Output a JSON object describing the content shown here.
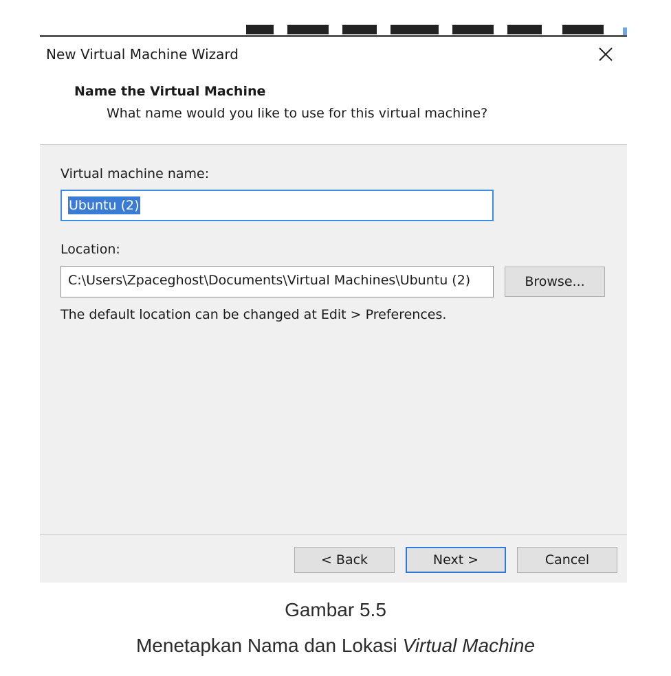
{
  "dialog": {
    "title": "New Virtual Machine Wizard",
    "header_title": "Name the Virtual Machine",
    "header_subtitle": "What name would you like to use for this virtual machine?",
    "name_label": "Virtual machine name:",
    "name_value": "Ubuntu (2)",
    "location_label": "Location:",
    "location_value": "C:\\Users\\Zpaceghost\\Documents\\Virtual Machines\\Ubuntu (2)",
    "browse_label": "Browse...",
    "hint": "The default location can be changed at Edit > Preferences.",
    "back_label": "< Back",
    "next_label": "Next >",
    "cancel_label": "Cancel"
  },
  "caption": {
    "figure": "Gambar 5.5",
    "text_plain": "Menetapkan Nama dan Lokasi ",
    "text_italic": "Virtual Machine"
  },
  "icons": {
    "close": "close-icon"
  },
  "colors": {
    "accent": "#3c8ce0",
    "selection": "#3a7bd5",
    "dialog_bg": "#f0f0f0"
  }
}
